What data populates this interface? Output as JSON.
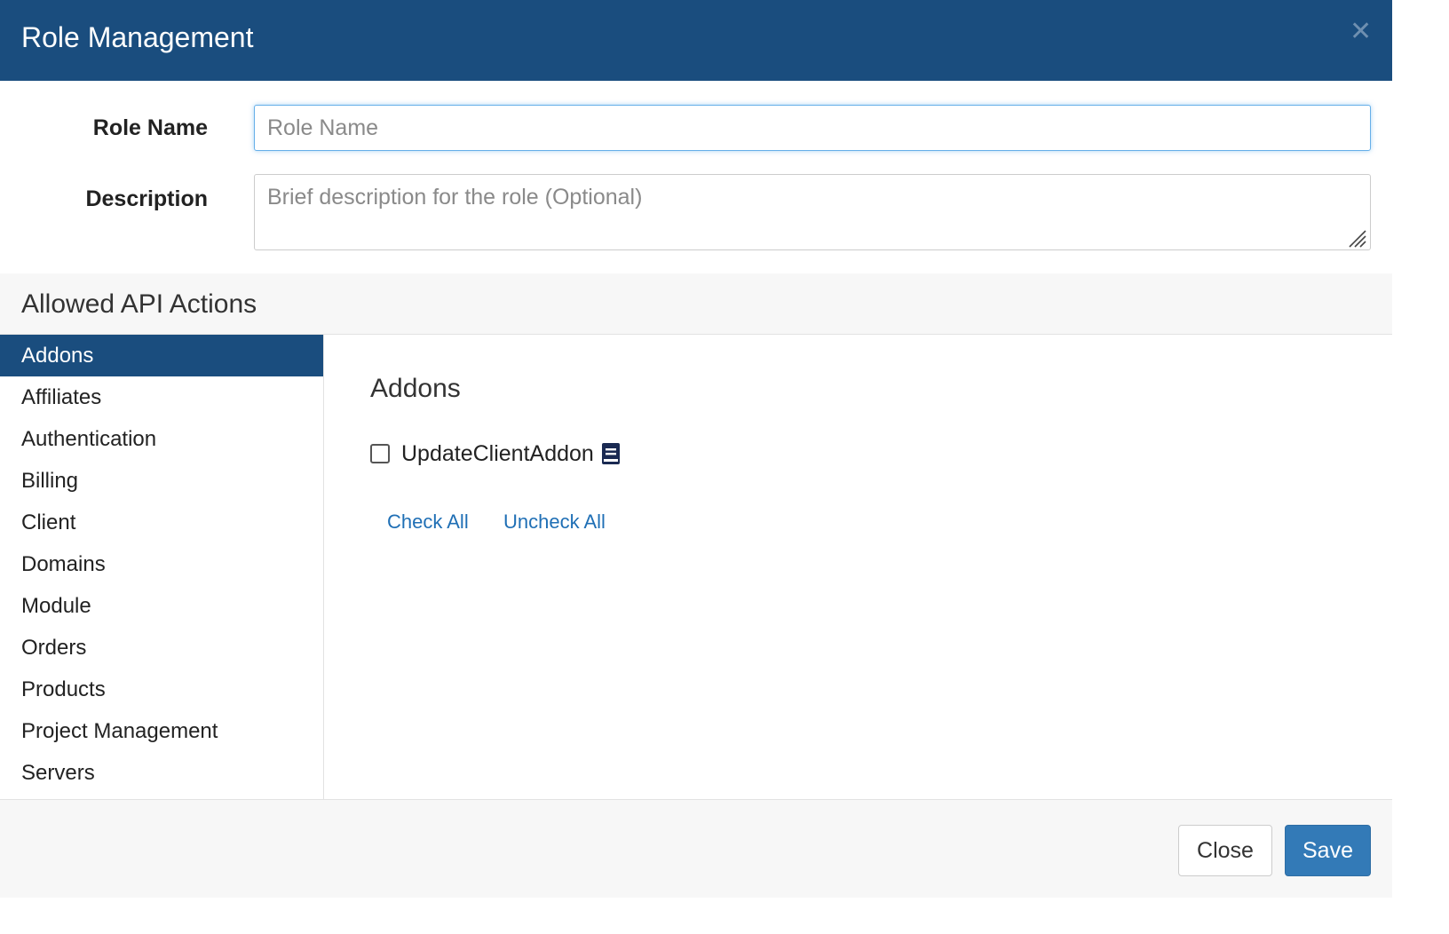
{
  "header": {
    "title": "Role Management",
    "close_icon": "close-icon"
  },
  "form": {
    "role_name_label": "Role Name",
    "role_name_placeholder": "Role Name",
    "role_name_value": "",
    "description_label": "Description",
    "description_placeholder": "Brief description for the role (Optional)",
    "description_value": ""
  },
  "section": {
    "title": "Allowed API Actions"
  },
  "sidebar": {
    "active_index": 0,
    "items": [
      {
        "label": "Addons"
      },
      {
        "label": "Affiliates"
      },
      {
        "label": "Authentication"
      },
      {
        "label": "Billing"
      },
      {
        "label": "Client"
      },
      {
        "label": "Domains"
      },
      {
        "label": "Module"
      },
      {
        "label": "Orders"
      },
      {
        "label": "Products"
      },
      {
        "label": "Project Management"
      },
      {
        "label": "Servers"
      }
    ]
  },
  "content": {
    "title": "Addons",
    "actions": [
      {
        "label": "UpdateClientAddon",
        "checked": false,
        "icon": "documentation-icon"
      }
    ],
    "check_all_label": "Check All",
    "uncheck_all_label": "Uncheck All"
  },
  "footer": {
    "close_label": "Close",
    "save_label": "Save"
  },
  "colors": {
    "header_bg": "#1a4d7e",
    "active_item_bg": "#1a4d7e",
    "link": "#1f6fb5",
    "save_button": "#337ab7"
  }
}
